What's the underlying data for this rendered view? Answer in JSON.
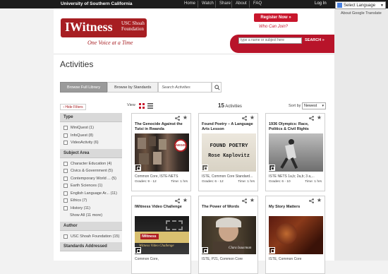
{
  "topbar": {
    "university": "University of Southern California",
    "nav": [
      "Home",
      "Watch",
      "Share",
      "About",
      "FAQ"
    ],
    "login": "Log In",
    "translate_label": "Select Language",
    "translate_note": "About Google Translate"
  },
  "header": {
    "logo_text": "IWitness",
    "logo_sub": "USC Shoah Foundation",
    "tagline": "One Voice at a Time",
    "register_label": "Register Now »",
    "who_label": "Who Can Join?",
    "search_placeholder": "type a name or subject here",
    "search_button": "SEARCH »"
  },
  "main": {
    "title": "Activities",
    "tabs": [
      "Browse Full Library",
      "Browse by Standards"
    ],
    "search_activities": "Search Activities",
    "hide_filters": "‹ Hide Filters",
    "view_label": "View",
    "count": "15",
    "count_label": "Activities",
    "sort_label": "Sort by",
    "sort_value": "Newest"
  },
  "sidebar": {
    "type_head": "Type",
    "type_items": [
      "MiniQuest (1)",
      "InfoQuest (8)",
      "VideoActivity (6)"
    ],
    "subject_head": "Subject Area",
    "subject_items": [
      "Character Education (4)",
      "Civics & Government (5)",
      "Contemporary World ... (5)",
      "Earth Sciences (1)",
      "English Language Ar... (11)",
      "Ethics (7)",
      "History (11)"
    ],
    "show_all": "Show All (11 more)",
    "author_head": "Author",
    "author_items": [
      "USC Shoah Foundation (15)"
    ],
    "standards_head": "Standards Addressed"
  },
  "cards": [
    {
      "title": "The Genocide Against the Tutsi in Rwanda",
      "meta": "Common Core, ISTE-NETS",
      "grades": "Grades: 9 - 12",
      "time": "Time: 1 hrs",
      "badge": "AEGIS"
    },
    {
      "title": "Found Poetry – A Language Arts Lesson",
      "meta": "ISTE, Common Core Standard...",
      "grades": "Grades: 6 - 12",
      "time": "Time: 1 hrs",
      "thumb_text1": "FOUND POETRY",
      "thumb_text2": "Rose Kaplovitz"
    },
    {
      "title": "1936 Olympics: Race, Politics & Civil Rights",
      "meta": "ISTE NETS 1a,b; 2a,b; 3 a,...",
      "grades": "Grades: 6 - 10",
      "time": "Time: 1 hrs"
    },
    {
      "title": "IWitness Video Challenge",
      "meta": "Common Core,",
      "grades": "",
      "time": "",
      "thumb_text1": "IWitness",
      "thumb_text2": "Witness Video Challenge"
    },
    {
      "title": "The Power of Words",
      "meta": "ISTE, P21, Common Core",
      "grades": "",
      "time": "",
      "thumb_text1": "Clara Isaacman"
    },
    {
      "title": "My Story Matters",
      "meta": "ISTE, Common Core",
      "grades": "",
      "time": ""
    }
  ]
}
